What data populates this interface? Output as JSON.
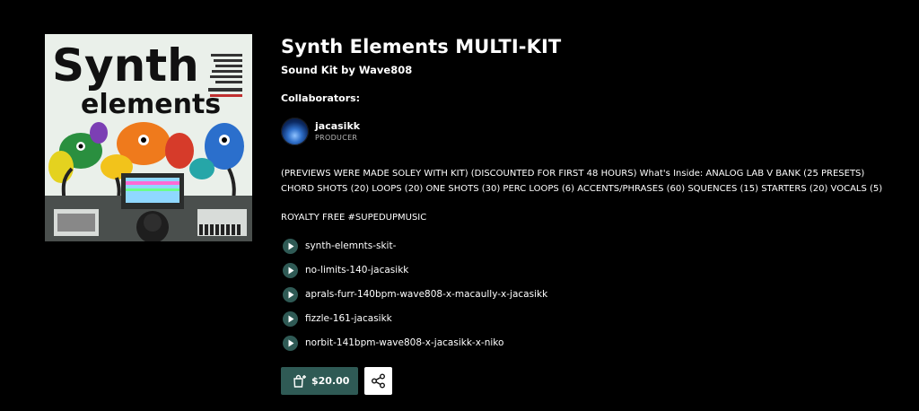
{
  "product": {
    "title": "Synth Elements MULTI-KIT",
    "subtitle": "Sound Kit by Wave808",
    "cover_art": {
      "alt_text": "Synth elements"
    }
  },
  "collaborators": {
    "heading": "Collaborators:",
    "items": [
      {
        "name": "jacasikk",
        "role": "PRODUCER"
      }
    ]
  },
  "description": "(PREVIEWS WERE MADE SOLEY WITH KIT) (DISCOUNTED FOR FIRST 48 HOURS) What's Inside: ANALOG LAB V BANK (25 PRESETS) CHORD SHOTS (20) LOOPS (20) ONE SHOTS (30) PERC LOOPS (6) ACCENTS/PHRASES (60) SQUENCES (15) STARTERS (20) VOCALS (5)",
  "royalty": "ROYALTY FREE #SUPEDUPMUSIC",
  "tracks": [
    {
      "name": "synth-elemnts-skit-"
    },
    {
      "name": "no-limits-140-jacasikk"
    },
    {
      "name": "aprals-furr-140bpm-wave808-x-macaully-x-jacasikk"
    },
    {
      "name": "fizzle-161-jacasikk"
    },
    {
      "name": "norbit-141bpm-wave808-x-jacasikk-x-niko"
    }
  ],
  "purchase": {
    "price": "$20.00",
    "icon": "shopping-bag-plus-icon"
  },
  "share": {
    "icon": "share-icon"
  },
  "colors": {
    "background": "#000000",
    "accent": "#2f5a55",
    "text": "#ffffff",
    "muted": "#b8b8b8"
  }
}
